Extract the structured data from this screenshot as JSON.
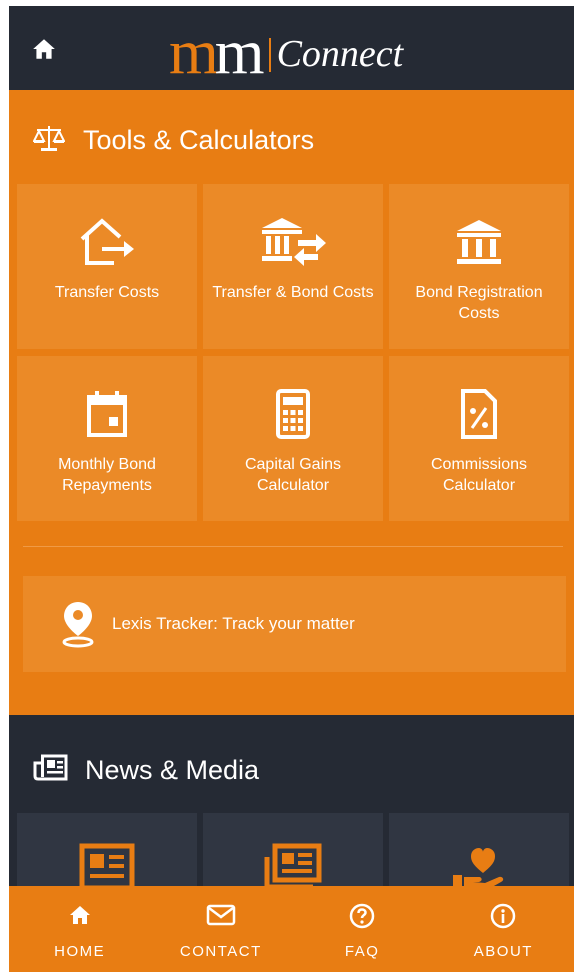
{
  "header": {
    "logo_mark": "mm",
    "logo_text": "Connect",
    "home_icon": "home-icon"
  },
  "tools": {
    "title": "Tools & Calculators",
    "icon": "scales-icon",
    "items": [
      {
        "label": "Transfer Costs",
        "icon": "house-transfer-icon"
      },
      {
        "label": "Transfer & Bond Costs",
        "icon": "bank-exchange-icon"
      },
      {
        "label": "Bond Registration Costs",
        "icon": "bank-icon"
      },
      {
        "label": "Monthly Bond Repayments",
        "icon": "calendar-icon"
      },
      {
        "label": "Capital Gains Calculator",
        "icon": "calculator-icon"
      },
      {
        "label": "Commissions Calculator",
        "icon": "percent-document-icon"
      }
    ]
  },
  "tracker": {
    "label": "Lexis Tracker: Track your matter",
    "icon": "location-pin-icon"
  },
  "news": {
    "title": "News & Media",
    "icon": "newspaper-icon",
    "tiles": [
      {
        "icon": "newspaper-icon"
      },
      {
        "icon": "newspapers-stack-icon"
      },
      {
        "icon": "hand-heart-icon"
      }
    ]
  },
  "tabbar": {
    "items": [
      {
        "label": "HOME",
        "icon": "home-icon"
      },
      {
        "label": "CONTACT",
        "icon": "envelope-icon"
      },
      {
        "label": "FAQ",
        "icon": "question-circle-icon"
      },
      {
        "label": "ABOUT",
        "icon": "info-circle-icon"
      }
    ]
  },
  "colors": {
    "accent": "#e87d13",
    "tile": "#eb8a27",
    "dark": "#252a34"
  }
}
